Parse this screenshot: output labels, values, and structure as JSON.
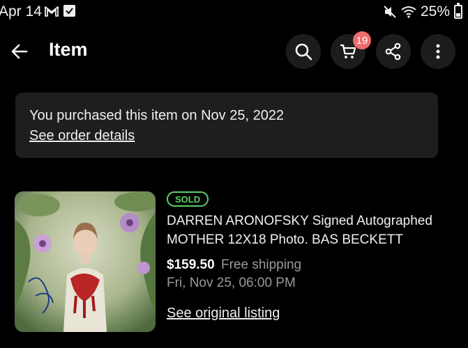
{
  "status_bar": {
    "date": "Apr 14",
    "icons": [
      "gmail-icon",
      "checkbox-icon",
      "mute-icon",
      "wifi-icon",
      "battery-icon"
    ],
    "battery": "25%"
  },
  "app_bar": {
    "title": "Item",
    "cart_count": "19",
    "icons": [
      "back-arrow-icon",
      "search-icon",
      "cart-icon",
      "share-icon",
      "more-vert-icon"
    ]
  },
  "notice": {
    "message": "You purchased this item on Nov 25, 2022",
    "link": "See order details"
  },
  "item": {
    "status_badge": "SOLD",
    "title": "DARREN ARONOFSKY Signed Autographed MOTHER 12X18 Photo. BAS BECKETT",
    "price": "$159.50",
    "shipping": "Free shipping",
    "date": "Fri, Nov 25, 06:00 PM",
    "link": "See original listing"
  },
  "colors": {
    "background": "#000000",
    "card": "#1e1e1e",
    "button": "#1c1c1c",
    "badge": "#f06c6c",
    "sold": "#5fd06a",
    "muted_text": "#9a9a9a"
  }
}
